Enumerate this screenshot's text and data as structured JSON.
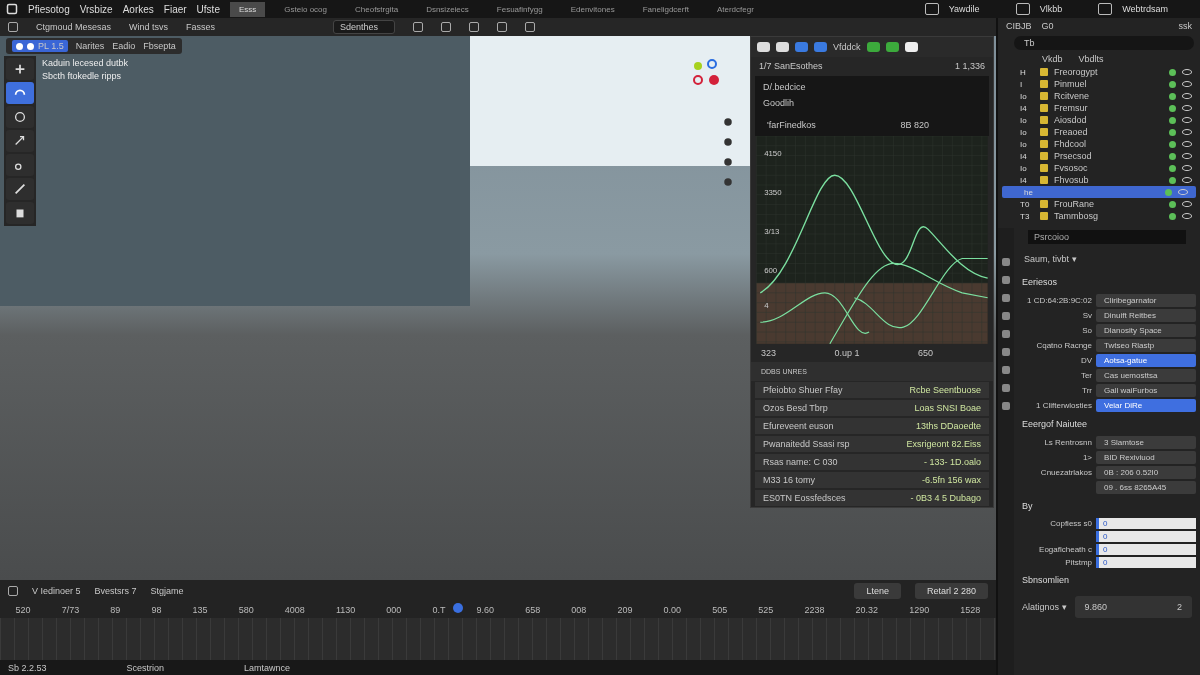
{
  "menubar": {
    "menus": [
      "Pfiesotog",
      "Vrsbize",
      "Aorkes",
      "Fiaer",
      "Ufste"
    ],
    "workspaces": [
      {
        "label": "Esss",
        "selected": true
      },
      {
        "label": "Gsteio ocog",
        "selected": false
      },
      {
        "label": "Cheofstrgita",
        "selected": false
      },
      {
        "label": "Dsnsizeiecs",
        "selected": false
      },
      {
        "label": "Fesuafinfygg",
        "selected": false
      },
      {
        "label": "Edenvitones",
        "selected": false
      },
      {
        "label": "Faneligdcerft",
        "selected": false
      },
      {
        "label": "Aterdcfegr",
        "selected": false
      }
    ],
    "right": [
      "Yawdile",
      "Vlkbb",
      "Webtrdsam"
    ]
  },
  "toolbar": {
    "items": [
      "Ctgmoud Mesesas",
      "Wind tsvs",
      "Fasses"
    ],
    "search": {
      "value": "Sdenthes"
    }
  },
  "viewport": {
    "header_items": [
      "Narites",
      "Eadio",
      "Fbsepta"
    ],
    "header_value": "PL 1.5",
    "info_lines": [
      "Kaduin lecesed dutbk",
      "Sbcth ftokedle   ripps"
    ],
    "tools": [
      {
        "selected": false
      },
      {
        "selected": true
      },
      {
        "selected": false
      },
      {
        "selected": false
      },
      {
        "selected": false
      },
      {
        "selected": false
      },
      {
        "selected": false
      }
    ]
  },
  "graph_panel": {
    "toolbar_label": "Vfddck",
    "title": "1/7 SanEsothes",
    "title_value": "1 1,336",
    "lines": [
      "D/.bedcice",
      "Goodlih"
    ],
    "header_left": "'farFinedkos",
    "header_right": "8B 820",
    "y_labels": [
      "4150",
      "3350",
      "3/13",
      "600",
      "4"
    ],
    "x_labels": [
      "323",
      "0.up 1",
      "650"
    ],
    "section": "DDBS UNRES",
    "rows": [
      {
        "left": "Pfeiobto Shuer Ffay",
        "right": "Rcbe Seentbuose"
      },
      {
        "left": "Ozos Besd Tbrp",
        "right": "Loas SNSI Boae"
      },
      {
        "left": "Efureveent euson",
        "right": "13ths DDaoedte"
      },
      {
        "left": "Pwanaitedd Ssasi rsp",
        "right": "Exsrigeont 82.Eiss"
      },
      {
        "left": "Rsas name:  C 030",
        "right": "- 133-  1D.oalo"
      },
      {
        "left": "M33  16 tomy",
        "right": "-6.5fn  156 wax"
      },
      {
        "left": "ES0TN Eossfedsces",
        "right": "- 0B3  4  5 Dubago"
      }
    ]
  },
  "outliner": {
    "title": "CIBJB",
    "title_value": "G0",
    "title_right": "ssk",
    "search": {
      "value": "Tb"
    },
    "columns": [
      "Vkdb",
      "Vbdlts"
    ],
    "rows": [
      {
        "prefix": "H",
        "name": "Freorogypt",
        "selected": false
      },
      {
        "prefix": "I",
        "name": "Pinmuel",
        "selected": false
      },
      {
        "prefix": "Io",
        "name": "Rcitvene",
        "selected": false
      },
      {
        "prefix": "I4",
        "name": "Fremsur",
        "selected": false
      },
      {
        "prefix": "Io",
        "name": "Aiosdod",
        "selected": false
      },
      {
        "prefix": "Io",
        "name": "Freaoed",
        "selected": false
      },
      {
        "prefix": "Io",
        "name": "Fhdcool",
        "selected": false
      },
      {
        "prefix": "I4",
        "name": "Prsecsod",
        "selected": false
      },
      {
        "prefix": "Io",
        "name": "Fvsosoc",
        "selected": false
      },
      {
        "prefix": "I4",
        "name": "Fhvosub",
        "selected": false
      },
      {
        "prefix": "he",
        "selected": true
      },
      {
        "prefix": "T0",
        "name": "FrouRane",
        "selected": false
      },
      {
        "prefix": "T3",
        "name": "Tammbosg",
        "selected": false
      }
    ]
  },
  "properties": {
    "field": "Psrcoioo",
    "mode": "Saum, tivbt ▾",
    "sections": [
      {
        "title": "Eeriesos",
        "rows": [
          {
            "label": "1  CD:64:2B:9C:02",
            "value": "Cliribegarnator",
            "selected": false
          },
          {
            "label": "Sv",
            "value": "Dinuift Reitbes",
            "selected": false
          },
          {
            "label": "So",
            "value": "Dlanosity Space",
            "selected": false
          },
          {
            "label": "Cqatno Racnge",
            "value": "Twtseo Rlastp",
            "selected": false
          },
          {
            "label": "DV",
            "value": "Aotsa-gatue",
            "selected": true
          },
          {
            "label": "Ter",
            "value": "Cas uemosttsa",
            "selected": false
          },
          {
            "label": "Trr",
            "value": "Gall waiFurbos",
            "selected": false
          },
          {
            "label": "1 Clifterwlosties",
            "value": "Veiar DiRe",
            "selected": true
          }
        ]
      },
      {
        "title": "Eeergof Naiutee",
        "rows": [
          {
            "label": "Ls Rentrosnn",
            "value": "3 Slamtose",
            "selected": false
          },
          {
            "label": "1>",
            "value": "BID Rexiviuod",
            "selected": false
          },
          {
            "label": "Cnuezatrlakos",
            "value": "0B : 206  0.52I0",
            "selected": false
          },
          {
            "value": "09 . 6ss  8265A45",
            "selected": false
          }
        ]
      }
    ],
    "by": {
      "title": "By",
      "fields": [
        {
          "label": "Copfiess s0",
          "value": "0"
        },
        {
          "value": "0"
        },
        {
          "label": "Eogaflcheath c",
          "value": "0"
        },
        {
          "label": "Pitstmp",
          "value": "0"
        }
      ]
    },
    "last": {
      "title": "Sbnsomlien",
      "label": "Alatignos ▾",
      "value": "9.860",
      "suffix": "2"
    }
  },
  "timeline": {
    "header": [
      "V Iedinoer  5",
      "Bvestsrs  7",
      "Stgjame"
    ],
    "right_button": "Ltene",
    "frame_field": "Retarl 2   280",
    "ticks": [
      "520",
      "7/73",
      "89",
      "98",
      "135",
      "580",
      "4008",
      "1130",
      "000",
      "0.T",
      "9.60",
      "658",
      "008",
      "209",
      "0.00",
      "505",
      "525",
      "2238",
      "20.32",
      "1290",
      "1528"
    ],
    "playhead": {
      "level": 0.46
    }
  },
  "status_bar": [
    "Sb 2.2.53",
    "Scestrion",
    "Lamtawnce"
  ]
}
